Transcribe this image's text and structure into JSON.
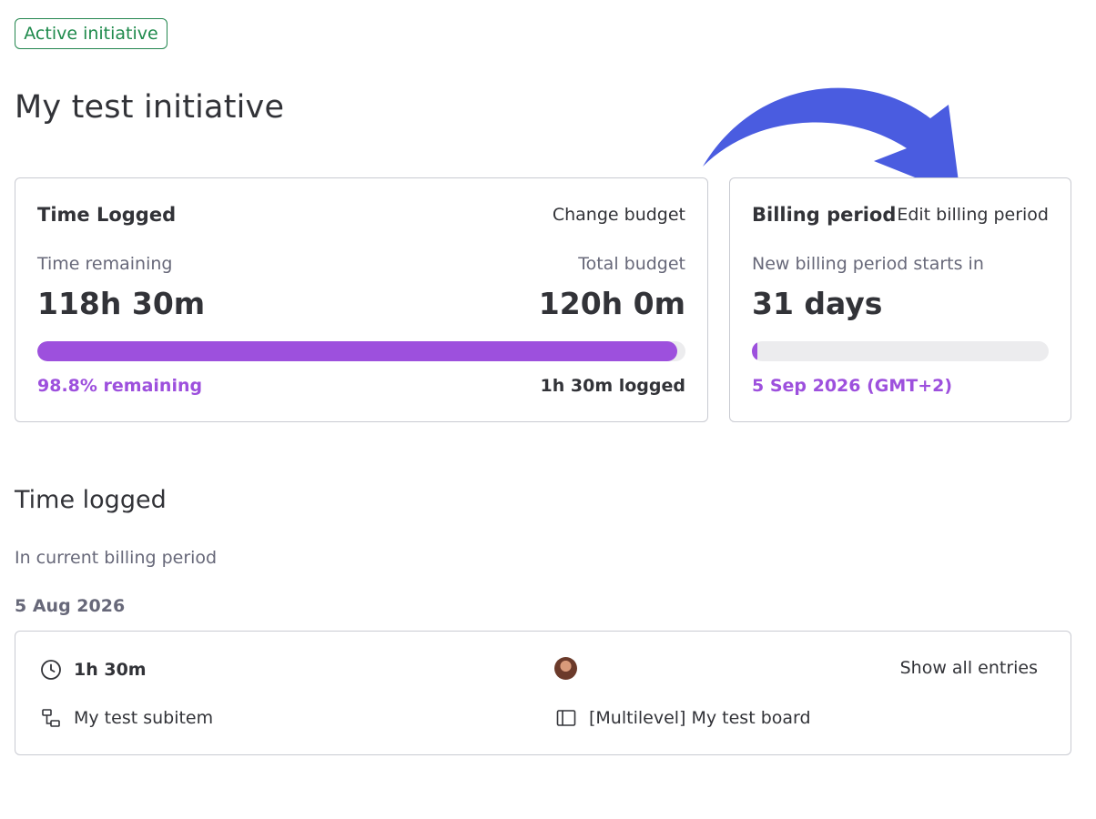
{
  "status_badge": "Active initiative",
  "page_title": "My test initiative",
  "time_card": {
    "title": "Time Logged",
    "action": "Change budget",
    "remaining_label": "Time remaining",
    "total_label": "Total budget",
    "remaining_value": "118h 30m",
    "total_value": "120h 0m",
    "progress_percent": 98.8,
    "remaining_pct_text": "98.8% remaining",
    "logged_text": "1h 30m logged"
  },
  "billing_card": {
    "title": "Billing period",
    "action": "Edit billing period",
    "starts_label": "New billing period starts in",
    "days_value": "31 days",
    "progress_percent": 1,
    "date_text": "5 Sep 2026 (GMT+2)"
  },
  "time_logged_section": {
    "title": "Time logged",
    "subtitle": "In current billing period",
    "date": "5 Aug 2026",
    "entry": {
      "duration": "1h 30m",
      "show_all": "Show all entries",
      "item_name": "My test subitem",
      "board_name": "[Multilevel] My test board"
    }
  },
  "colors": {
    "accent_purple": "#9d50dd",
    "status_green": "#1f8a4c",
    "annotation_arrow": "#4a5ce0"
  },
  "icons": [
    "clock-icon",
    "subitem-icon",
    "board-icon",
    "avatar",
    "arrow-annotation"
  ]
}
